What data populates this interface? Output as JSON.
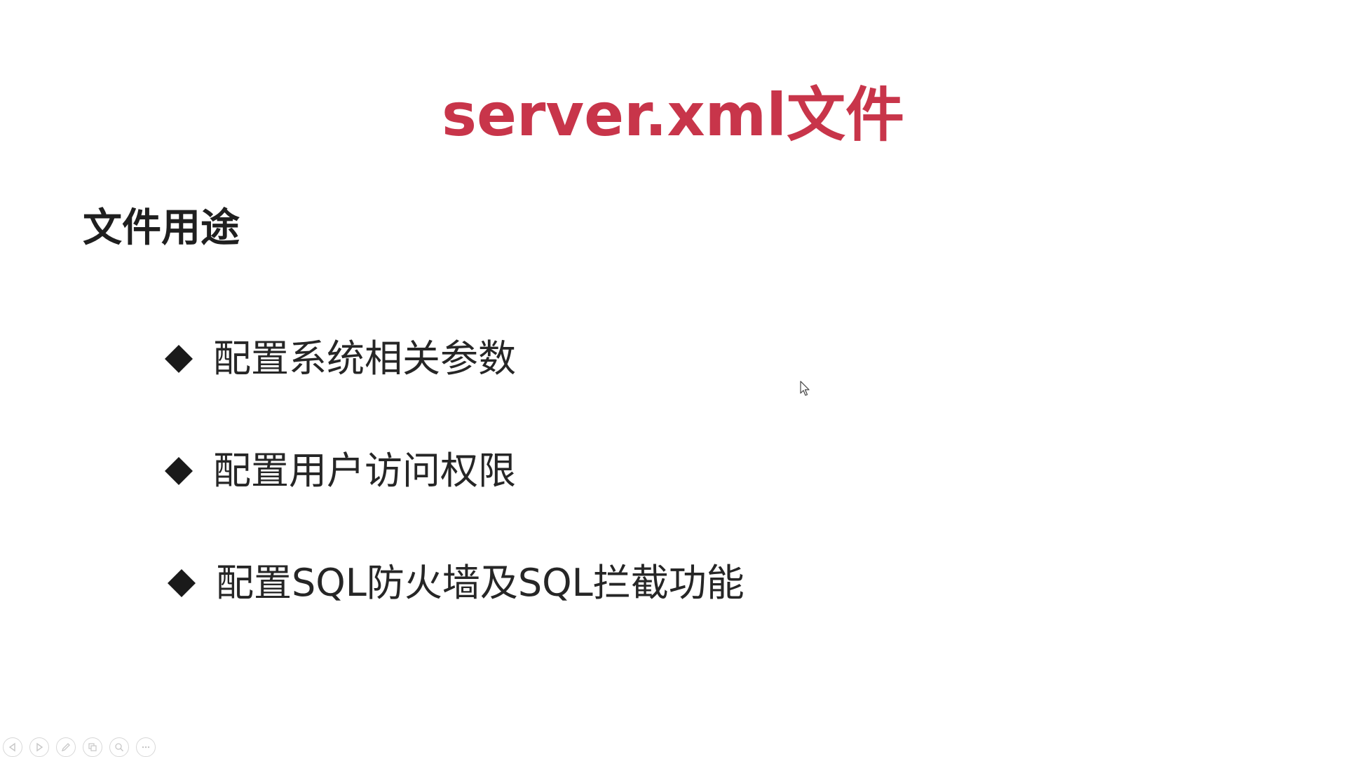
{
  "slide": {
    "title": "server.xml文件",
    "section_heading": "文件用途",
    "bullets": [
      {
        "text": "配置系统相关参数"
      },
      {
        "text": "配置用户访问权限"
      },
      {
        "text": "配置SQL防火墙及SQL拦截功能"
      }
    ],
    "colors": {
      "title": "#c8354a",
      "heading": "#1f1f1f",
      "bullet_text": "#262626",
      "bullet_marker": "#1a1a1a",
      "background": "#ffffff"
    }
  },
  "toolbar": {
    "buttons": [
      {
        "icon": "previous-icon"
      },
      {
        "icon": "next-icon"
      },
      {
        "icon": "pen-icon"
      },
      {
        "icon": "slides-icon"
      },
      {
        "icon": "zoom-icon"
      },
      {
        "icon": "more-icon"
      }
    ]
  }
}
